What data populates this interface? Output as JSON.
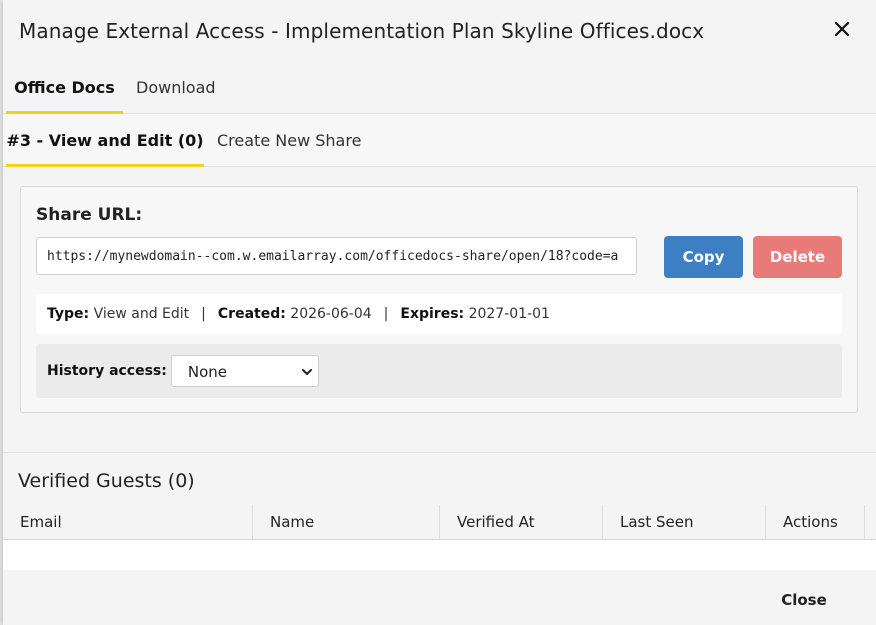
{
  "dialog": {
    "title": "Manage External Access - Implementation Plan Skyline Offices.docx",
    "close_icon": "close-icon"
  },
  "tabs": [
    {
      "label": "Office Docs",
      "active": true
    },
    {
      "label": "Download",
      "active": false
    }
  ],
  "subtabs": [
    {
      "label": "#3 - View and Edit (0)",
      "active": true
    },
    {
      "label": "Create New Share",
      "active": false
    }
  ],
  "share": {
    "label": "Share URL:",
    "url": "https://mynewdomain--com.w.emailarray.com/officedocs-share/open/18?code=a",
    "copy_label": "Copy",
    "delete_label": "Delete",
    "meta": {
      "type_label": "Type:",
      "type_value": "View and Edit",
      "created_label": "Created:",
      "created_value": "2026-06-04",
      "expires_label": "Expires:",
      "expires_value": "2027-01-01",
      "separator": "|"
    },
    "history": {
      "label": "History access:",
      "selected": "None"
    }
  },
  "guests": {
    "title": "Verified Guests (0)",
    "columns": [
      "Email",
      "Name",
      "Verified At",
      "Last Seen",
      "Actions"
    ],
    "rows": []
  },
  "footer": {
    "close_label": "Close"
  },
  "colors": {
    "accent_tab": "#f2d21c",
    "copy_button": "#3c7fc2",
    "delete_button": "#e87a7a"
  }
}
